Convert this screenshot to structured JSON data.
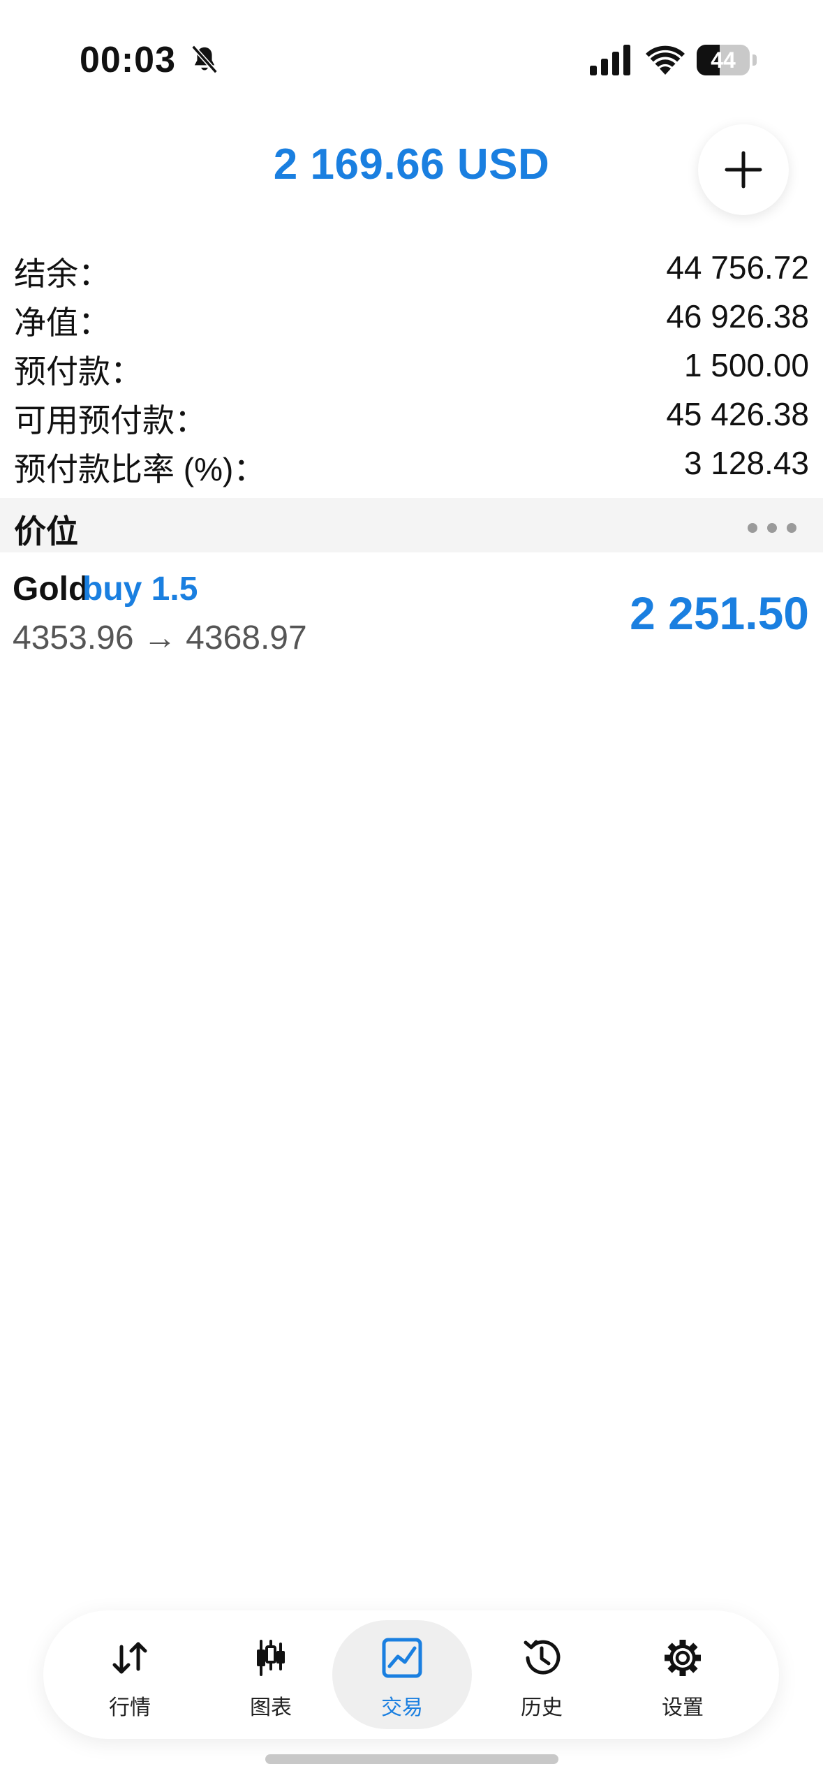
{
  "status_bar": {
    "time": "00:03",
    "battery_percent": "44",
    "battery_level": 0.44,
    "icons": [
      "bell-slash-icon",
      "cellular-signal-icon",
      "wifi-icon",
      "battery-icon"
    ]
  },
  "header": {
    "title": "2 169.66 USD",
    "add_icon": "plus-icon"
  },
  "account": [
    {
      "label": "结余：",
      "value": "44 756.72"
    },
    {
      "label": "净值：",
      "value": "46 926.38"
    },
    {
      "label": "预付款：",
      "value": "1 500.00"
    },
    {
      "label": "可用预付款：",
      "value": "45 426.38"
    },
    {
      "label": "预付款比率 (%)：",
      "value": "3 128.43"
    }
  ],
  "section": {
    "title": "价位",
    "more_icon": "more-horizontal-icon"
  },
  "position": {
    "symbol": "Gold",
    "direction": "buy 1.5",
    "prices": "4353.96 → 4368.97",
    "profit": "2 251.50"
  },
  "tabs": [
    {
      "label": "行情",
      "icon": "quotes-arrows-icon",
      "active": false
    },
    {
      "label": "图表",
      "icon": "candlestick-icon",
      "active": false
    },
    {
      "label": "交易",
      "icon": "trade-chart-icon",
      "active": true
    },
    {
      "label": "历史",
      "icon": "history-icon",
      "active": false
    },
    {
      "label": "设置",
      "icon": "settings-gear-icon",
      "active": false
    }
  ],
  "colors": {
    "accent": "#1a7fe0",
    "text": "#111111",
    "muted": "#555555",
    "section_bg": "#f4f4f4"
  }
}
